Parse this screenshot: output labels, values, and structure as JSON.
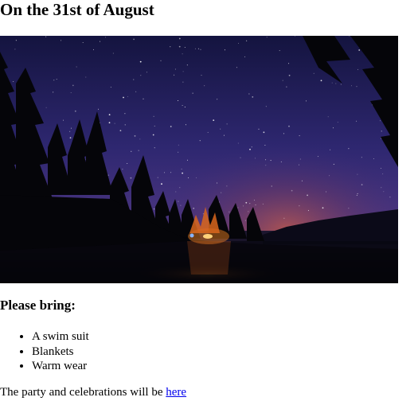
{
  "page": {
    "title": "On the 31st of August"
  },
  "photo": {
    "subject": "night-sky-campfire-lake",
    "sky_top_color": "#1b1a4f",
    "sky_mid_color": "#3a2d7a",
    "horizon_glow_color": "#b8554a",
    "fire_color": "#ff9a2a",
    "silhouette_color": "#05050c"
  },
  "bring": {
    "heading": "Please bring:",
    "items": [
      "A swim suit",
      "Blankets",
      "Warm wear"
    ]
  },
  "footer": {
    "text": "The party and celebrations will be ",
    "link_label": "here"
  }
}
